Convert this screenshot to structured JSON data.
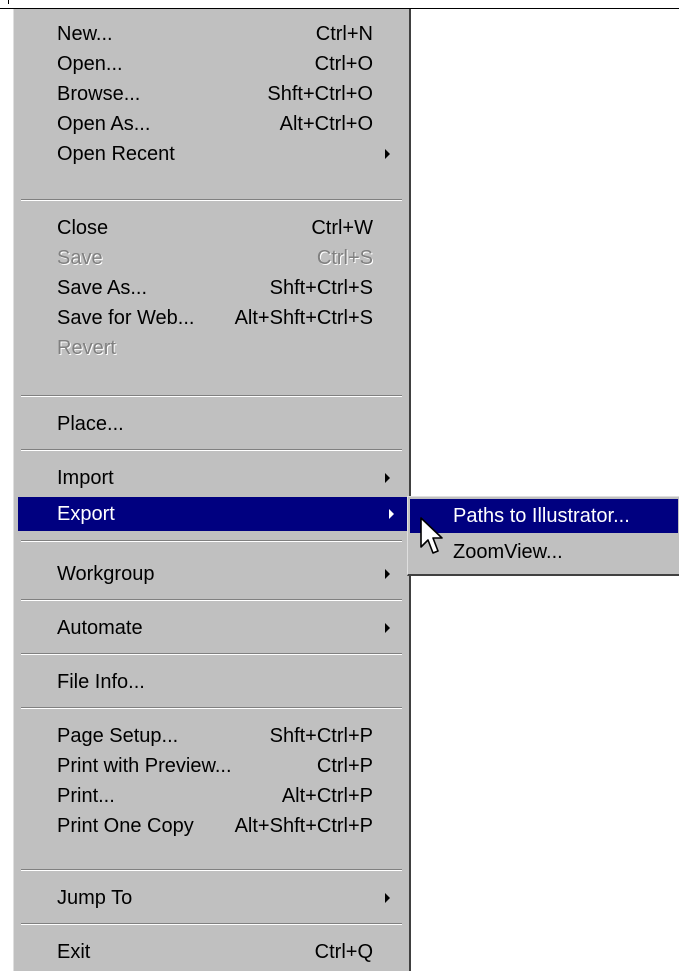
{
  "menu": {
    "items": [
      {
        "label": "New...",
        "shortcut": "Ctrl+N"
      },
      {
        "label": "Open...",
        "shortcut": "Ctrl+O"
      },
      {
        "label": "Browse...",
        "shortcut": "Shft+Ctrl+O"
      },
      {
        "label": "Open As...",
        "shortcut": "Alt+Ctrl+O"
      },
      {
        "label": "Open Recent",
        "shortcut": ""
      },
      {
        "label": "Close",
        "shortcut": "Ctrl+W"
      },
      {
        "label": "Save",
        "shortcut": "Ctrl+S"
      },
      {
        "label": "Save As...",
        "shortcut": "Shft+Ctrl+S"
      },
      {
        "label": "Save for Web...",
        "shortcut": "Alt+Shft+Ctrl+S"
      },
      {
        "label": "Revert",
        "shortcut": ""
      },
      {
        "label": "Place...",
        "shortcut": ""
      },
      {
        "label": "Import",
        "shortcut": ""
      },
      {
        "label": "Export",
        "shortcut": ""
      },
      {
        "label": "Workgroup",
        "shortcut": ""
      },
      {
        "label": "Automate",
        "shortcut": ""
      },
      {
        "label": "File Info...",
        "shortcut": ""
      },
      {
        "label": "Page Setup...",
        "shortcut": "Shft+Ctrl+P"
      },
      {
        "label": "Print with Preview...",
        "shortcut": "Ctrl+P"
      },
      {
        "label": "Print...",
        "shortcut": "Alt+Ctrl+P"
      },
      {
        "label": "Print One Copy",
        "shortcut": "Alt+Shft+Ctrl+P"
      },
      {
        "label": "Jump To",
        "shortcut": ""
      },
      {
        "label": "Exit",
        "shortcut": "Ctrl+Q"
      }
    ]
  },
  "submenu": {
    "items": [
      {
        "label": "Paths to Illustrator..."
      },
      {
        "label": "ZoomView..."
      }
    ]
  },
  "colors": {
    "menu_bg": "#c0c0c0",
    "highlight": "#000080",
    "disabled_text": "#808080"
  }
}
